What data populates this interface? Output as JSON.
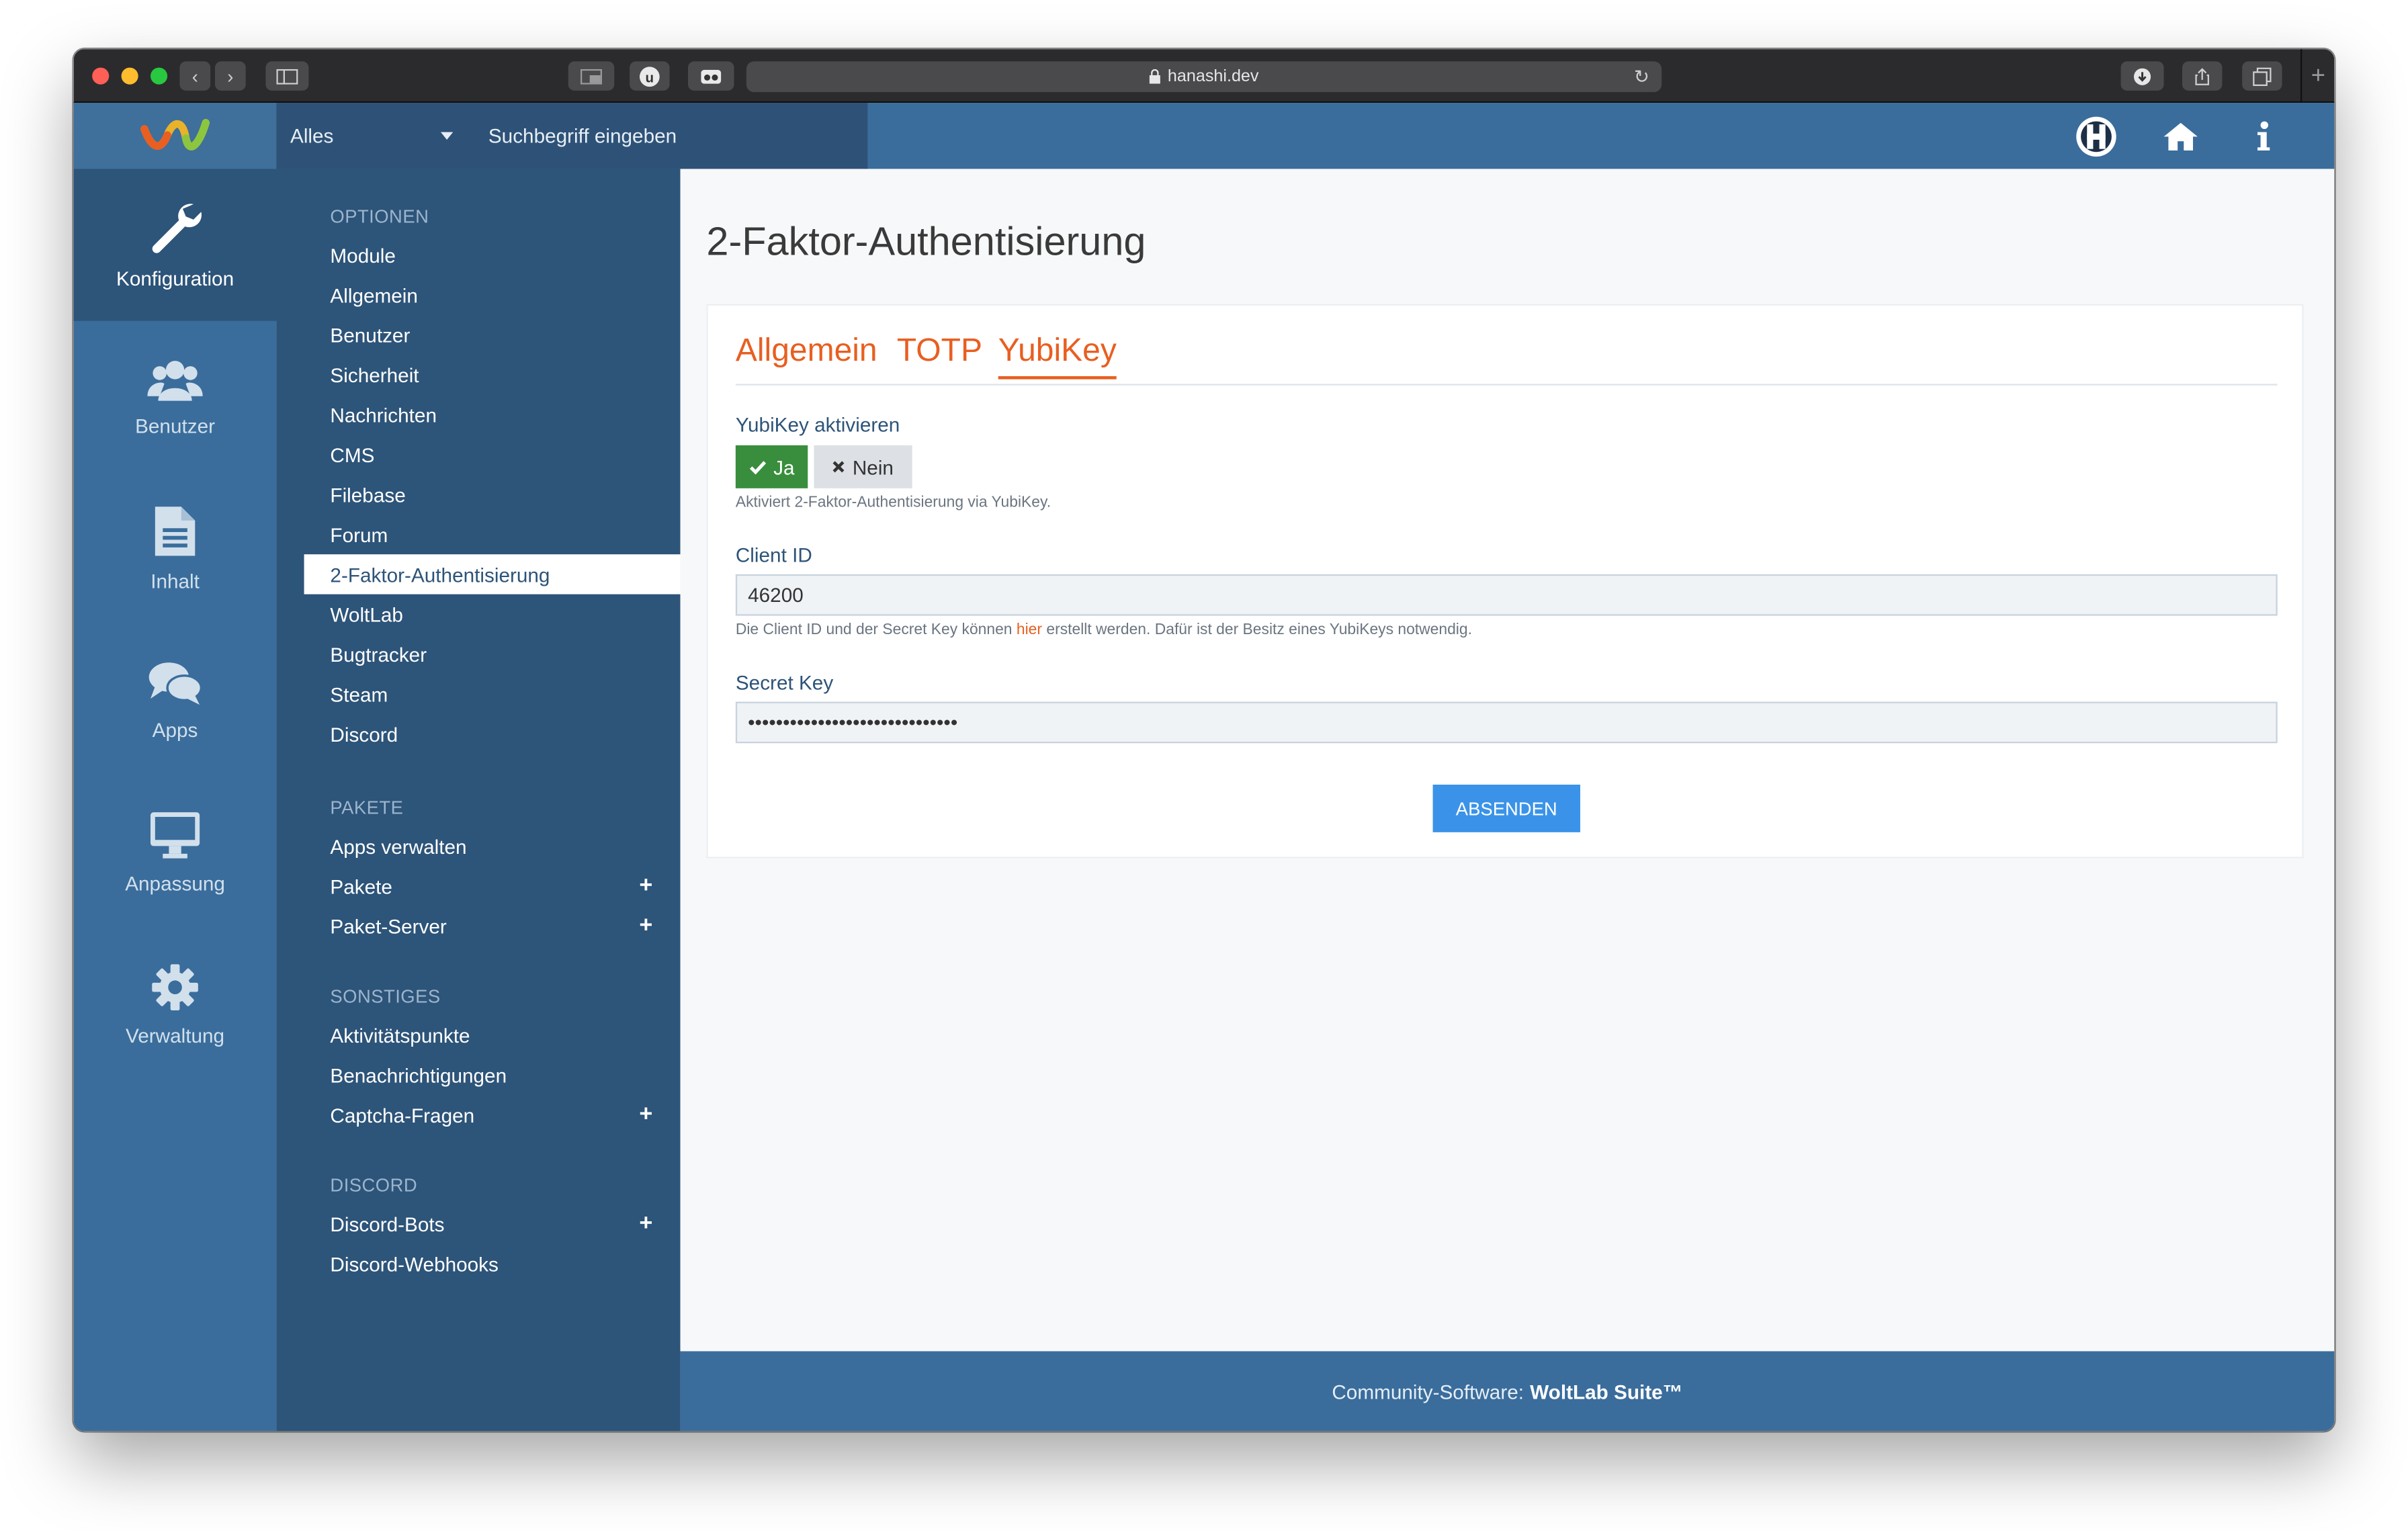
{
  "browser": {
    "url": "hanashi.dev",
    "new_tab_symbol": "+"
  },
  "header": {
    "search_scope": "Alles",
    "search_placeholder": "Suchbegriff eingeben"
  },
  "icon_menu": [
    {
      "label": "Konfiguration",
      "icon": "wrench-icon",
      "active": true
    },
    {
      "label": "Benutzer",
      "icon": "users-icon",
      "active": false
    },
    {
      "label": "Inhalt",
      "icon": "document-icon",
      "active": false
    },
    {
      "label": "Apps",
      "icon": "comments-icon",
      "active": false
    },
    {
      "label": "Anpassung",
      "icon": "monitor-icon",
      "active": false
    },
    {
      "label": "Verwaltung",
      "icon": "gear-icon",
      "active": false
    }
  ],
  "submenu": {
    "sections": [
      {
        "title": "OPTIONEN",
        "items": [
          "Module",
          "Allgemein",
          "Benutzer",
          "Sicherheit",
          "Nachrichten",
          "CMS",
          "Filebase",
          "Forum",
          "2-Faktor-Authentisierung",
          "WoltLab",
          "Bugtracker",
          "Steam",
          "Discord"
        ]
      },
      {
        "title": "PAKETE",
        "items": [
          "Apps verwalten",
          "Pakete",
          "Paket-Server"
        ]
      },
      {
        "title": "SONSTIGES",
        "items": [
          "Aktivitätspunkte",
          "Benachrichtigungen",
          "Captcha-Fragen"
        ]
      },
      {
        "title": "DISCORD",
        "items": [
          "Discord-Bots",
          "Discord-Webhooks"
        ]
      }
    ],
    "active_item": "2-Faktor-Authentisierung"
  },
  "main": {
    "title": "2-Faktor-Authentisierung",
    "tabs": [
      "Allgemein",
      "TOTP",
      "YubiKey"
    ],
    "active_tab": "YubiKey",
    "enable_label": "YubiKey aktivieren",
    "yes_label": "Ja",
    "no_label": "Nein",
    "enable_desc": "Aktiviert 2-Faktor-Authentisierung via YubiKey.",
    "client_id_label": "Client ID",
    "client_id_value": "46200",
    "client_id_desc_before": "Die Client ID und der Secret Key können",
    "client_id_desc_link": "hier",
    "client_id_desc_after": "erstellt werden. Dafür ist der Besitz eines YubiKeys notwendig.",
    "secret_key_label": "Secret Key",
    "secret_key_value": "••••••••••••••••••••••••••••••",
    "submit_label": "ABSENDEN"
  },
  "footer": {
    "prefix": "Community-Software:",
    "brand": "WoltLab Suite™"
  },
  "colors": {
    "header_blue": "#3a6d9c",
    "submenu_blue": "#2d5479",
    "accent_orange": "#e85f21",
    "success_green": "#388e3c",
    "button_blue": "#3a93e8"
  }
}
